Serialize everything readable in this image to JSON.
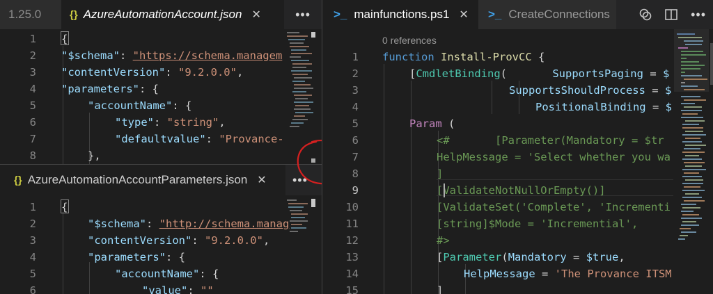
{
  "left_top": {
    "tabs": [
      {
        "label": "1.25.0",
        "icon": "none"
      },
      {
        "label": "AzureAutomationAccount.json",
        "icon": "json-braces-icon"
      }
    ],
    "more": "•••",
    "lines": [
      {
        "n": "1",
        "text": "{"
      },
      {
        "n": "2",
        "text": "\"$schema\": \"https://schema.managem"
      },
      {
        "n": "3",
        "text": "\"contentVersion\": \"9.2.0.0\","
      },
      {
        "n": "4",
        "text": "\"parameters\": {"
      },
      {
        "n": "5",
        "text": "\"accountName\": {"
      },
      {
        "n": "6",
        "text": "\"type\": \"string\","
      },
      {
        "n": "7",
        "text": "\"defaultvalue\": \"Provance-"
      },
      {
        "n": "8",
        "text": "},"
      }
    ]
  },
  "left_bottom": {
    "tab": {
      "label": "AzureAutomationAccountParameters.json",
      "icon": "json-braces-icon"
    },
    "more": "•••",
    "lines": [
      {
        "n": "1",
        "text": "{"
      },
      {
        "n": "2",
        "text": "\"$schema\": \"http://schema.manag"
      },
      {
        "n": "3",
        "text": "\"contentVersion\": \"9.2.0.0\","
      },
      {
        "n": "4",
        "text": "\"parameters\": {"
      },
      {
        "n": "5",
        "text": "\"accountName\": {"
      },
      {
        "n": "6",
        "text": "\"value\": \"\""
      }
    ]
  },
  "right": {
    "tabs": [
      {
        "label": "mainfunctions.ps1",
        "icon": "powershell-icon",
        "active": true
      },
      {
        "label": "CreateConnections",
        "icon": "powershell-icon",
        "active": false
      }
    ],
    "actions": [
      "compare-icon",
      "split-editor-icon"
    ],
    "more": "•••",
    "codelens": "0 references",
    "lines": [
      {
        "n": "1",
        "text": "function Install-ProvCC {"
      },
      {
        "n": "2",
        "text": "[CmdletBinding(       SupportsPaging = $"
      },
      {
        "n": "3",
        "text": "SupportsShouldProcess = $"
      },
      {
        "n": "4",
        "text": "PositionalBinding = $"
      },
      {
        "n": "5",
        "text": "Param ("
      },
      {
        "n": "6",
        "text": "<#       [Parameter(Mandatory = $tr"
      },
      {
        "n": "7",
        "text": "HelpMessage = 'Select whether you wa"
      },
      {
        "n": "8",
        "text": "]"
      },
      {
        "n": "9",
        "text": "[ValidateNotNullOrEmpty()]"
      },
      {
        "n": "10",
        "text": "[ValidateSet('Complete', 'Incrementi"
      },
      {
        "n": "11",
        "text": "[string]$Mode = 'Incremential',"
      },
      {
        "n": "12",
        "text": "#>"
      },
      {
        "n": "13",
        "text": "[Parameter(Mandatory = $true,"
      },
      {
        "n": "14",
        "text": "HelpMessage = 'The Provance ITSM"
      },
      {
        "n": "15",
        "text": "]"
      }
    ]
  },
  "colors": {
    "annotation_circle": "#d42020",
    "json_key": "#9cdcfe",
    "json_string": "#ce9178",
    "ps_keyword": "#569cd6",
    "ps_function": "#dcdcaa",
    "ps_comment": "#6a9955"
  }
}
